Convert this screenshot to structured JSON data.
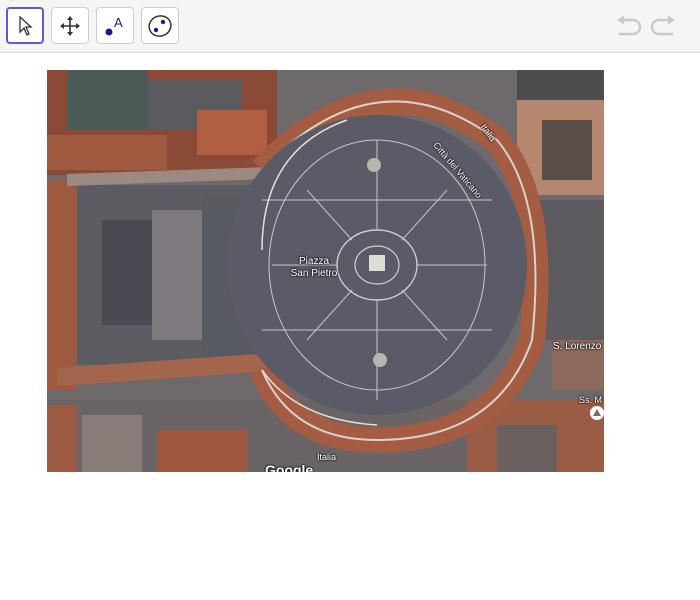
{
  "toolbar": {
    "tools": [
      {
        "name": "move-tool",
        "icon": "arrow-cursor-icon",
        "selected": true
      },
      {
        "name": "move-graphics-view-tool",
        "icon": "four-arrows-icon",
        "selected": false
      },
      {
        "name": "text-tool",
        "icon": "point-label-icon",
        "label": "A",
        "selected": false
      },
      {
        "name": "ellipse-tool",
        "icon": "ellipse-icon",
        "selected": false
      }
    ],
    "undo_icon": "undo-icon",
    "redo_icon": "redo-icon",
    "accent": "#6557d2"
  },
  "map": {
    "labels": {
      "square": "Piazza\nSan Pietro",
      "street_city": "Città del Vaticano",
      "street_italia_top": "Italia",
      "street_italia_bottom": "Italia",
      "lorenzo": "S. Lorenzo",
      "ss": "Ss. M",
      "google": "Google"
    }
  }
}
